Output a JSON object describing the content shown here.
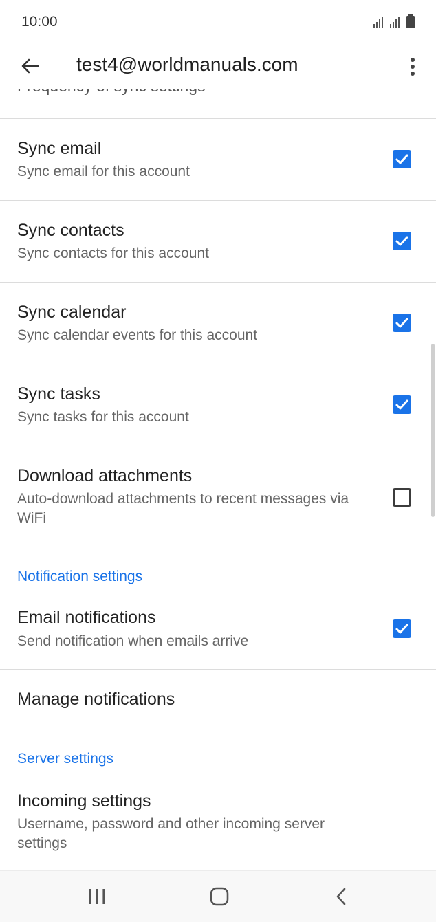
{
  "status": {
    "time": "10:00"
  },
  "appbar": {
    "title": "test4@worldmanuals.com"
  },
  "peek_text": "Frequency of sync settings",
  "items": [
    {
      "title": "Sync email",
      "subtitle": "Sync email for this account",
      "checked": true
    },
    {
      "title": "Sync contacts",
      "subtitle": "Sync contacts for this account",
      "checked": true
    },
    {
      "title": "Sync calendar",
      "subtitle": "Sync calendar events for this account",
      "checked": true
    },
    {
      "title": "Sync tasks",
      "subtitle": "Sync tasks for this account",
      "checked": true
    },
    {
      "title": "Download attachments",
      "subtitle": "Auto-download attachments to recent messages via WiFi",
      "checked": false
    }
  ],
  "notification_section": {
    "header": "Notification settings",
    "email_notifications": {
      "title": "Email notifications",
      "subtitle": "Send notification when emails arrive",
      "checked": true
    },
    "manage": {
      "title": "Manage notifications"
    }
  },
  "server_section": {
    "header": "Server settings",
    "incoming": {
      "title": "Incoming settings",
      "subtitle": "Username, password and other incoming server settings"
    }
  },
  "icons": {
    "back": "arrow-back-icon",
    "more": "more-vert-icon",
    "checkbox_checked": "checkbox-checked-icon",
    "checkbox_unchecked": "checkbox-unchecked-icon",
    "nav_recents": "recents-icon",
    "nav_home": "home-icon",
    "nav_back": "nav-back-icon"
  },
  "colors": {
    "accent": "#1a73e8",
    "checkbox_off": "#3c3c3c",
    "divider": "#dcdcdc"
  }
}
